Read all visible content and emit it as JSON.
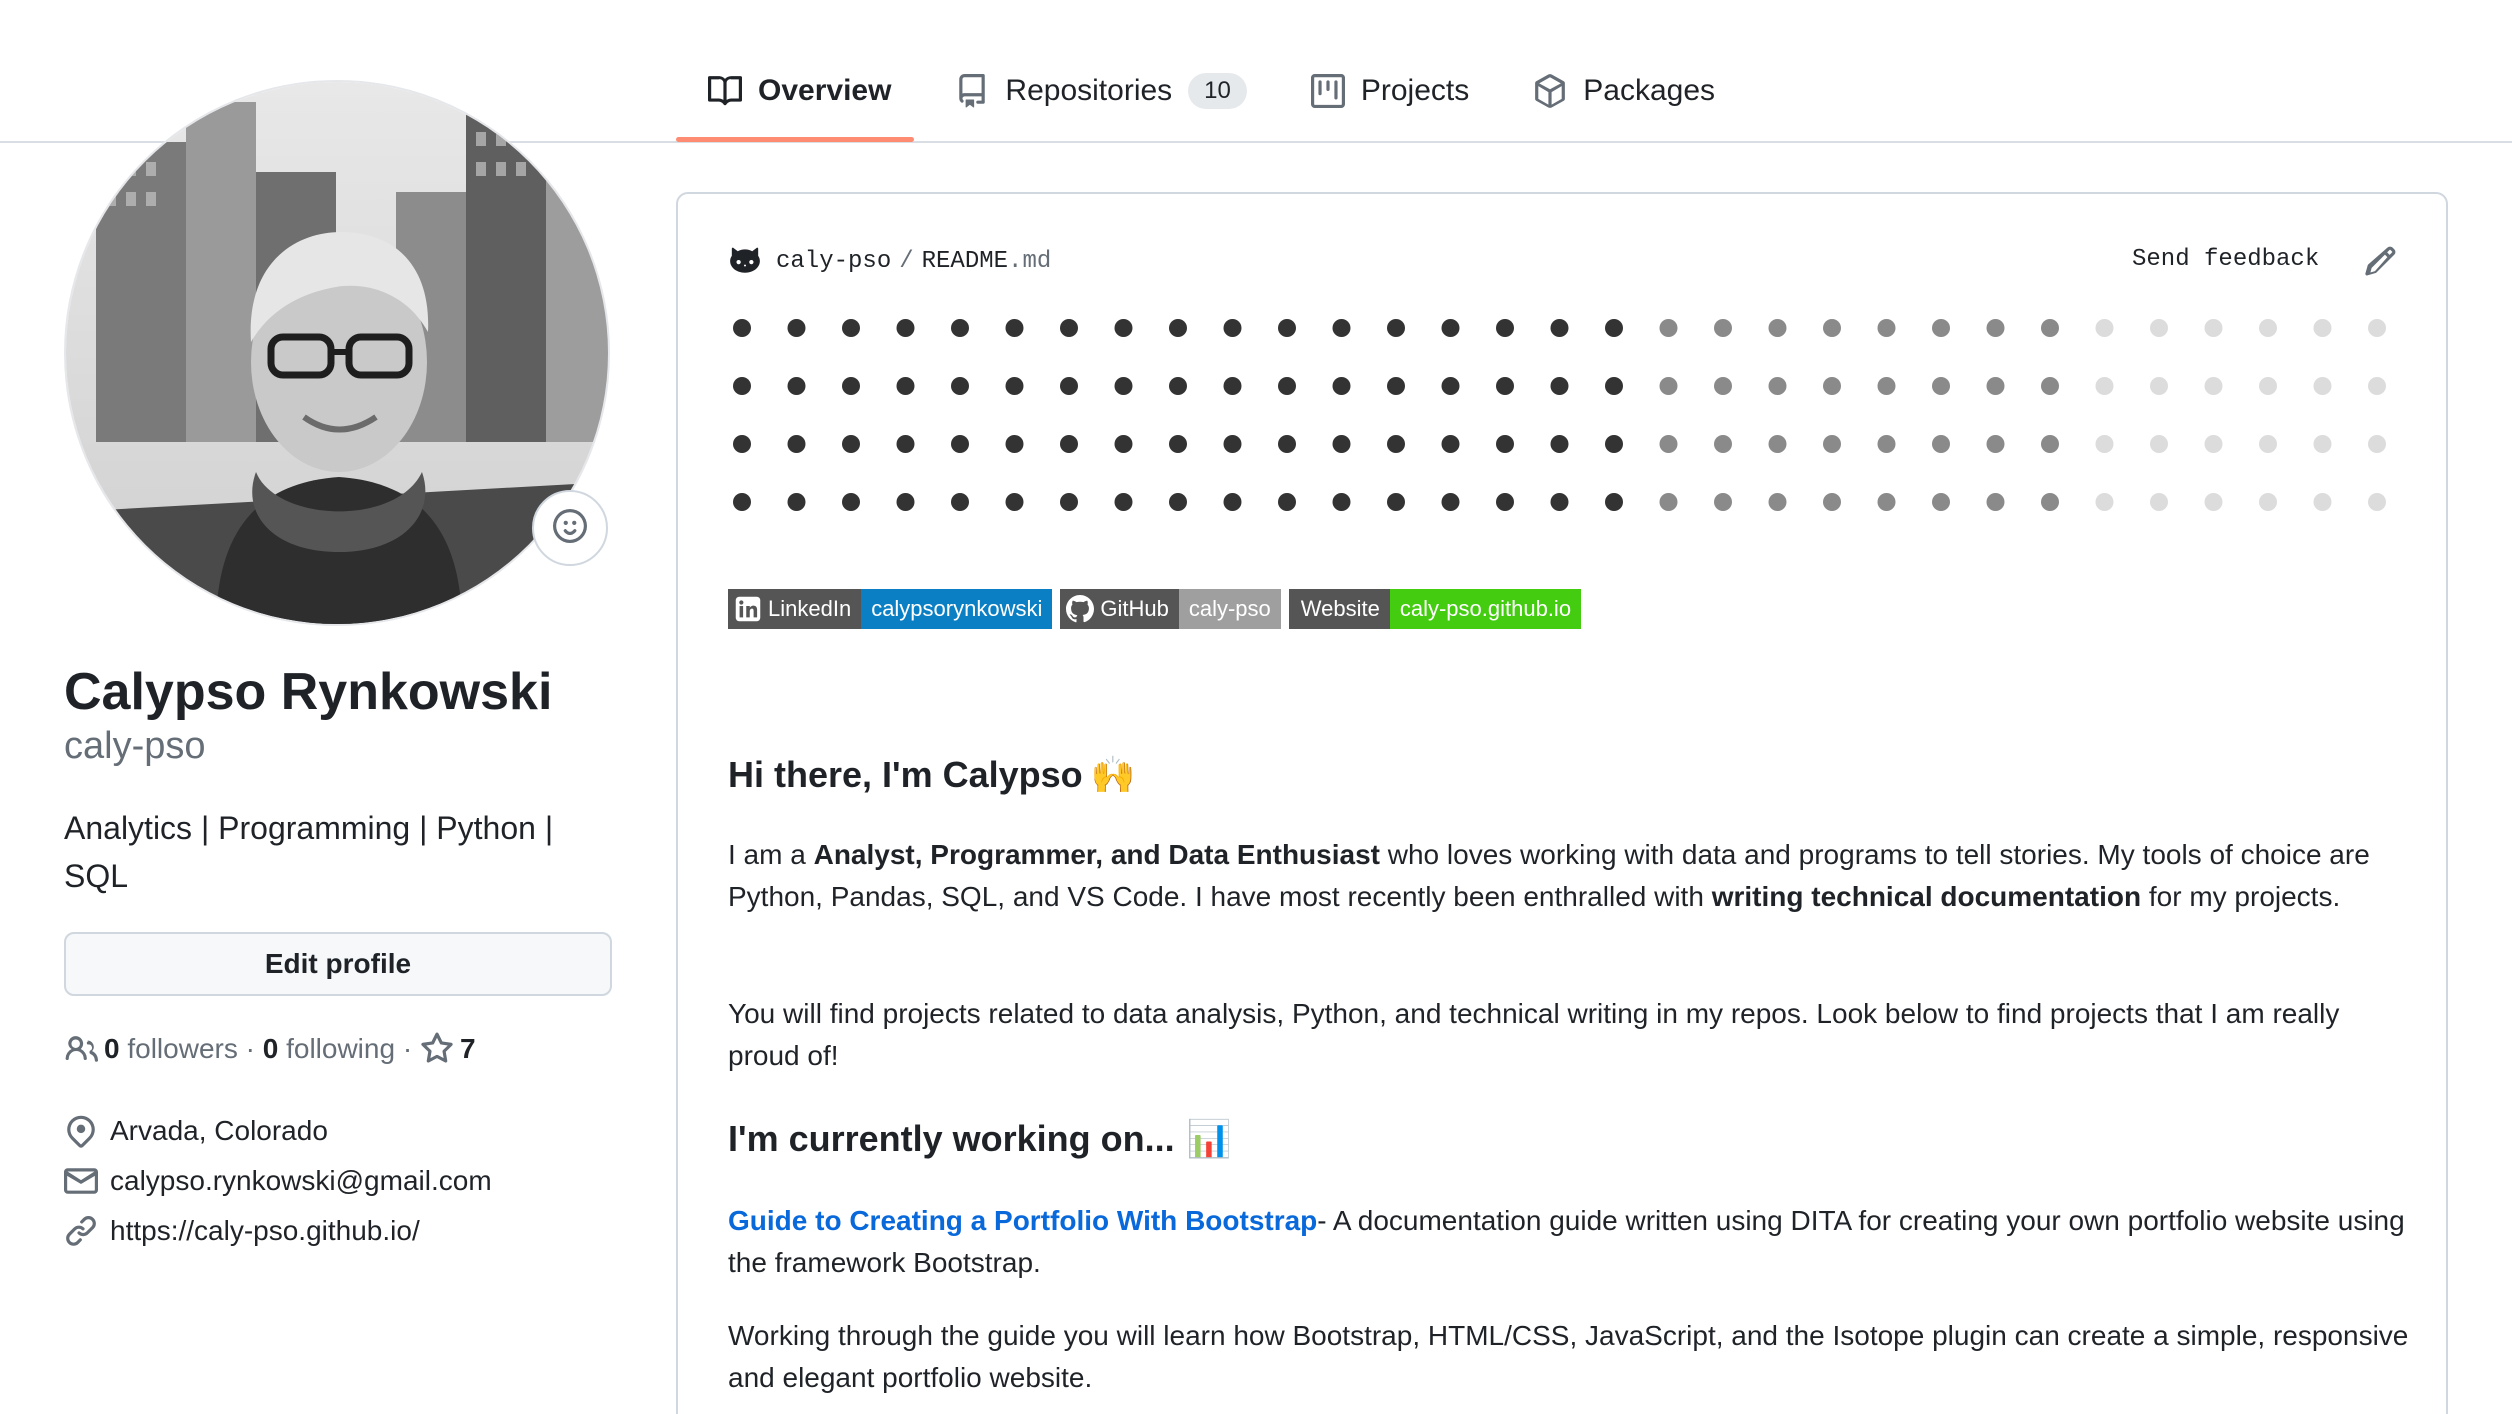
{
  "tabs": [
    {
      "label": "Overview",
      "icon": "book-icon",
      "active": true
    },
    {
      "label": "Repositories",
      "icon": "repo-icon",
      "count": "10"
    },
    {
      "label": "Projects",
      "icon": "project-board-icon"
    },
    {
      "label": "Packages",
      "icon": "package-icon"
    }
  ],
  "profile": {
    "full_name": "Calypso Rynkowski",
    "username": "caly-pso",
    "bio": "Analytics | Programming | Python | SQL",
    "edit_label": "Edit profile",
    "followers_count": "0",
    "followers_label": "followers",
    "following_count": "0",
    "following_label": "following",
    "stars_count": "7",
    "location": "Arvada, Colorado",
    "email": "calypso.rynkowski@gmail.com",
    "website": "https://caly-pso.github.io/"
  },
  "readme": {
    "owner": "caly-pso",
    "separator": "/",
    "file_name": "README",
    "file_ext": ".md",
    "feedback_label": "Send feedback",
    "badges": [
      {
        "label": "LinkedIn",
        "value": "calypsorynkowski",
        "color": "#0a7fc4",
        "icon": "linkedin-icon"
      },
      {
        "label": "GitHub",
        "value": "caly-pso",
        "color": "#9f9f9f",
        "icon": "github-icon"
      },
      {
        "label": "Website",
        "value": "caly-pso.github.io",
        "color": "#44cc11"
      }
    ],
    "heading1": "Hi there, I'm Calypso",
    "heading1_emoji": "🙌",
    "intro_a": "I am a ",
    "intro_bold1": "Analyst, Programmer, and Data Enthusiast",
    "intro_b": " who loves working with data and programs to tell stories. My tools of choice are Python, Pandas, SQL, and VS Code. I have most recently been enthralled with ",
    "intro_bold2": "writing technical documentation",
    "intro_c": " for my projects.",
    "para2": "You will find projects related to data analysis, Python, and technical writing in my repos. Look below to find projects that I am really proud of!",
    "heading2": "I'm currently working on...",
    "heading2_emoji": "📊",
    "guide_link": "Guide to Creating a Portfolio With Bootstrap",
    "guide_text": "- A documentation guide written using DITA for creating your own portfolio website using the framework Bootstrap.",
    "para4": "Working through the guide you will learn how Bootstrap, HTML/CSS, JavaScript, and the Isotope plugin can create a simple, responsive and elegant portfolio website."
  },
  "colors": {
    "accent_underline": "#fd8c73",
    "link": "#0969da",
    "dot_dark": "#333333",
    "dot_mid": "#8a8a8a",
    "dot_light": "#dcdcdc"
  }
}
